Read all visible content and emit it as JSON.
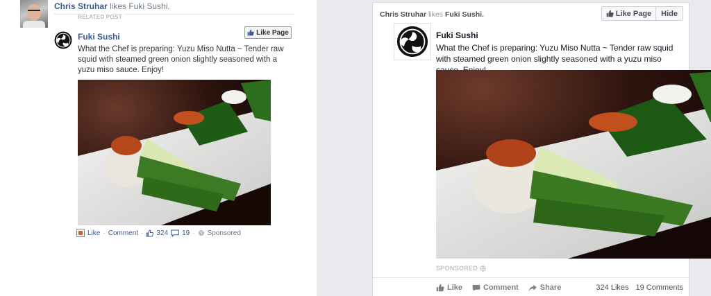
{
  "left": {
    "actor": "Chris Struhar",
    "story_suffix": " likes Fuki Sushi.",
    "related_label": "RELATED POST",
    "page_name": "Fuki Sushi",
    "like_page_label": "Like Page",
    "post_text": "What the Chef is preparing: Yuzu Miso Nutta ~ Tender raw squid with steamed green onion slightly seasoned with a yuzu miso sauce. Enjoy!",
    "footer": {
      "like": "Like",
      "comment": "Comment",
      "likes_count": "324",
      "comments_count": "19",
      "sponsored": "Sponsored"
    }
  },
  "right": {
    "actor": "Chris Struhar",
    "verb": " likes ",
    "page_ref": "Fuki Sushi.",
    "like_page_label": "Like Page",
    "hide_label": "Hide",
    "page_name": "Fuki Sushi",
    "post_text": "What the Chef is preparing: Yuzu Miso Nutta ~ Tender raw squid with steamed green onion slightly seasoned with a yuzu miso sauce. Enjoy!",
    "sponsored": "SPONSORED",
    "actions": {
      "like": "Like",
      "comment": "Comment",
      "share": "Share"
    },
    "counts": {
      "likes": "324 Likes",
      "comments": "19 Comments"
    }
  },
  "colors": {
    "fb_blue": "#3b5998",
    "grey_text": "#6d7686",
    "feed_bg": "#e9eaed",
    "card_border": "#d3d6db"
  },
  "icons": [
    "like-thumb-icon",
    "comment-icon",
    "share-icon",
    "globe-icon",
    "page-logo-icon"
  ]
}
